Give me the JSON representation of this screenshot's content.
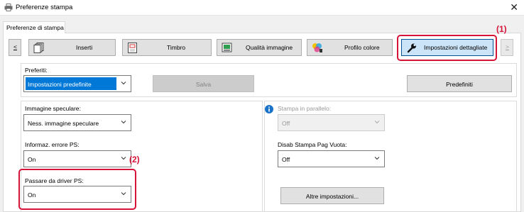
{
  "window": {
    "title": "Preferenze stampa",
    "close_glyph": "✕"
  },
  "tab": {
    "label": "Preferenze di stampa"
  },
  "toolbar": {
    "prev_label": "<",
    "next_label": ">",
    "buttons": [
      {
        "label": "Inserti",
        "icon": "inserts-icon"
      },
      {
        "label": "Timbro",
        "icon": "stamp-icon"
      },
      {
        "label": "Qualità immagine",
        "icon": "image-quality-icon"
      },
      {
        "label": "Profilo colore",
        "icon": "color-profile-icon"
      },
      {
        "label": "Impostazioni dettagliate",
        "icon": "wrench-icon"
      }
    ],
    "active_index": 4
  },
  "callouts": {
    "one": "(1)",
    "two": "(2)"
  },
  "favorites": {
    "label": "Preferiti:",
    "value": "Impostazioni predefinite",
    "save_label": "Salva",
    "defaults_label": "Predefiniti"
  },
  "left": {
    "mirror_label": "Immagine speculare:",
    "mirror_value": "Ness. immagine speculare",
    "ps_error_label": "Informaz. errore PS:",
    "ps_error_value": "On",
    "ps_driver_label": "Passare da driver PS:",
    "ps_driver_value": "On"
  },
  "right": {
    "parallel_label": "Stampa in parallelo:",
    "parallel_value": "Off",
    "blank_label": "Disab Stampa Pag Vuota:",
    "blank_value": "Off",
    "other_label": "Altre impostazioni..."
  },
  "colors": {
    "accent": "#0078d7",
    "callout": "#d6143a"
  }
}
